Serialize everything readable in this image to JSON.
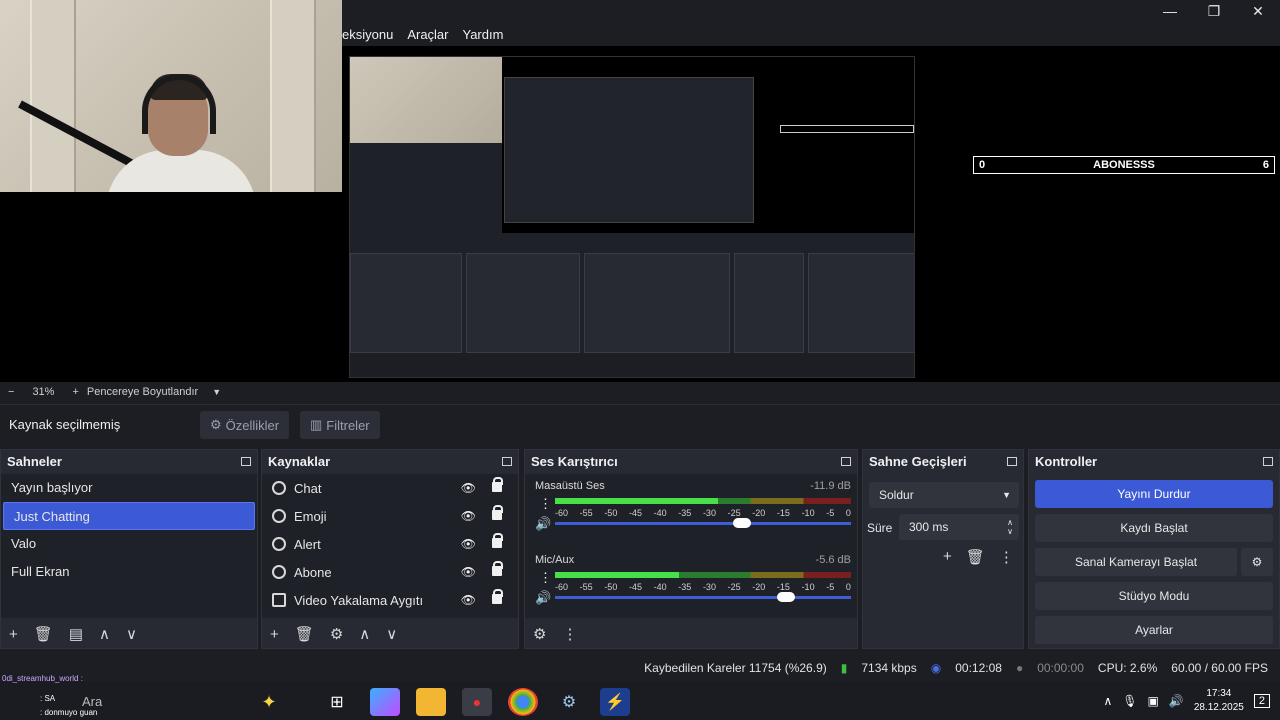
{
  "window": {
    "minimize": "—",
    "maximize": "❐",
    "close": "✕"
  },
  "menu": [
    "eksiyonu",
    "Araçlar",
    "Yardım"
  ],
  "overlay": {
    "counter_left": "0",
    "counter_title": "ABONESSS",
    "counter_right": "6"
  },
  "zoom": {
    "minus": "−",
    "value": "31%",
    "plus": "+",
    "mode": "Pencereye Boyutlandır"
  },
  "source_toolbar": {
    "label": "Kaynak seçilmemiş",
    "properties": "Özellikler",
    "filters": "Filtreler"
  },
  "docks": {
    "scenes": {
      "title": "Sahneler",
      "items": [
        "Yayın başlıyor",
        "Just Chatting",
        "Valo",
        "Full Ekran"
      ],
      "active": 1
    },
    "sources": {
      "title": "Kaynaklar",
      "items": [
        "Chat",
        "Emoji",
        "Alert",
        "Abone",
        "Video Yakalama Aygıtı"
      ]
    },
    "mixer": {
      "title": "Ses Karıştırıcı",
      "channels": [
        {
          "name": "Masaüstü Ses",
          "db": "-11.9 dB",
          "level": 0.55,
          "volume": 0.6
        },
        {
          "name": "Mic/Aux",
          "db": "-5.6 dB",
          "level": 0.42,
          "volume": 0.75
        }
      ],
      "ticks": [
        "-60",
        "-55",
        "-50",
        "-45",
        "-40",
        "-35",
        "-30",
        "-25",
        "-20",
        "-15",
        "-10",
        "-5",
        "0"
      ]
    },
    "transitions": {
      "title": "Sahne Geçişleri",
      "transition": "Soldur",
      "duration_label": "Süre",
      "duration": "300 ms"
    },
    "controls": {
      "title": "Kontroller",
      "stop_stream": "Yayını Durdur",
      "start_recording": "Kaydı Başlat",
      "virtual_camera": "Sanal Kamerayı Başlat",
      "studio_mode": "Stüdyo Modu",
      "settings": "Ayarlar"
    }
  },
  "status": {
    "dropped_frames": "Kaybedilen Kareler 11754 (%26.9)",
    "bitrate": "7134 kbps",
    "stream_time": "00:12:08",
    "rec_time": "00:00:00",
    "cpu": "CPU: 2.6%",
    "fps": "60.00 / 60.00 FPS"
  },
  "taskbar": {
    "search": "Ara",
    "time": "17:34",
    "date": "28.12.2025",
    "notification_count": "2",
    "chat_line1": "0di_streamhub_world :",
    "chat_line2": ": SA",
    "chat_line3": ": donmuyo guan"
  },
  "colors": {
    "accent": "#3c59d6",
    "panel": "#272a33",
    "background": "#1c1e24"
  }
}
